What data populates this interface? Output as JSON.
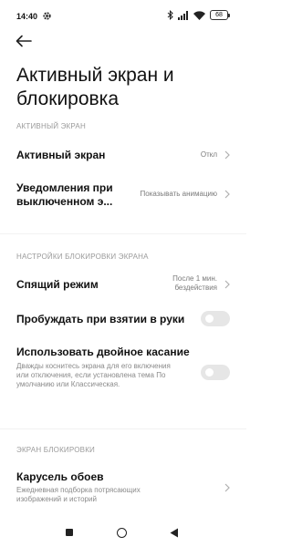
{
  "status_bar": {
    "time": "14:40",
    "battery": "68",
    "icons": [
      "gear-icon",
      "bluetooth-icon",
      "signal-icon",
      "wifi-icon",
      "battery-icon"
    ]
  },
  "page": {
    "title": "Активный экран и блокировка"
  },
  "sections": [
    {
      "header": "АКТИВНЫЙ ЭКРАН",
      "items": [
        {
          "title": "Активный экран",
          "value": "Откл"
        },
        {
          "title": "Уведомления при выключенном э...",
          "value": "Показывать анимацию"
        }
      ]
    },
    {
      "header": "НАСТРОЙКИ БЛОКИРОВКИ ЭКРАНА",
      "items": [
        {
          "title": "Спящий режим",
          "value": "После 1 мин. бездействия"
        },
        {
          "title": "Пробуждать при взятии в руки",
          "toggle": false
        },
        {
          "title": "Использовать двойное касание",
          "description": "Дважды коснитесь экрана для его включения или отключения, если установлена тема По умолчанию или Классическая.",
          "toggle": false
        }
      ]
    },
    {
      "header": "ЭКРАН БЛОКИРОВКИ",
      "items": [
        {
          "title": "Карусель обоев",
          "description": "Ежедневная подборка потрясающих изображений и историй"
        }
      ]
    }
  ],
  "colors": {
    "text_primary": "#111111",
    "text_secondary": "#7a7a7a",
    "section_header": "#9a9a9a",
    "toggle_off": "#e6e6e6",
    "background": "#ffffff"
  }
}
